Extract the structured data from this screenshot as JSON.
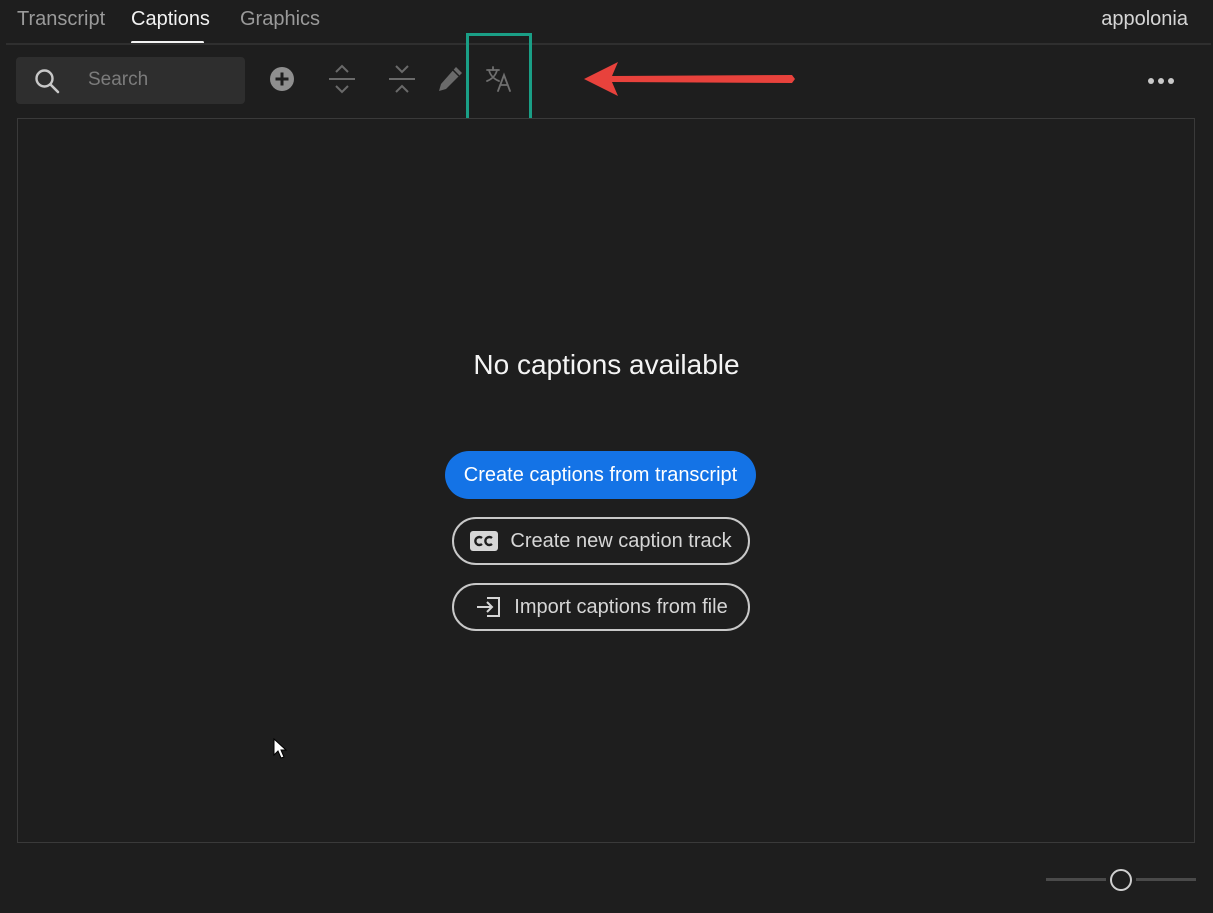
{
  "tabs": [
    {
      "label": "Transcript",
      "active": false
    },
    {
      "label": "Captions",
      "active": true
    },
    {
      "label": "Graphics",
      "active": false
    }
  ],
  "user": {
    "name": "appolonia"
  },
  "search": {
    "placeholder": "Search",
    "value": ""
  },
  "toolbar": {
    "icons": [
      "search-icon",
      "add-caption-icon",
      "split-caption-icon",
      "merge-caption-icon",
      "edit-pencil-icon",
      "translate-icon",
      "more-options-icon"
    ]
  },
  "annotation": {
    "highlight_color": "#1a9f86",
    "arrow_color": "#e8423c"
  },
  "main": {
    "empty_title": "No captions available",
    "primary_button": "Create captions from transcript",
    "secondary_buttons": [
      {
        "label": "Create new caption track",
        "icon": "cc-icon"
      },
      {
        "label": "Import captions from file",
        "icon": "import-icon"
      }
    ]
  },
  "zoom": {
    "level": 0.5
  },
  "colors": {
    "accent": "#1473e6",
    "background": "#1e1e1e"
  }
}
